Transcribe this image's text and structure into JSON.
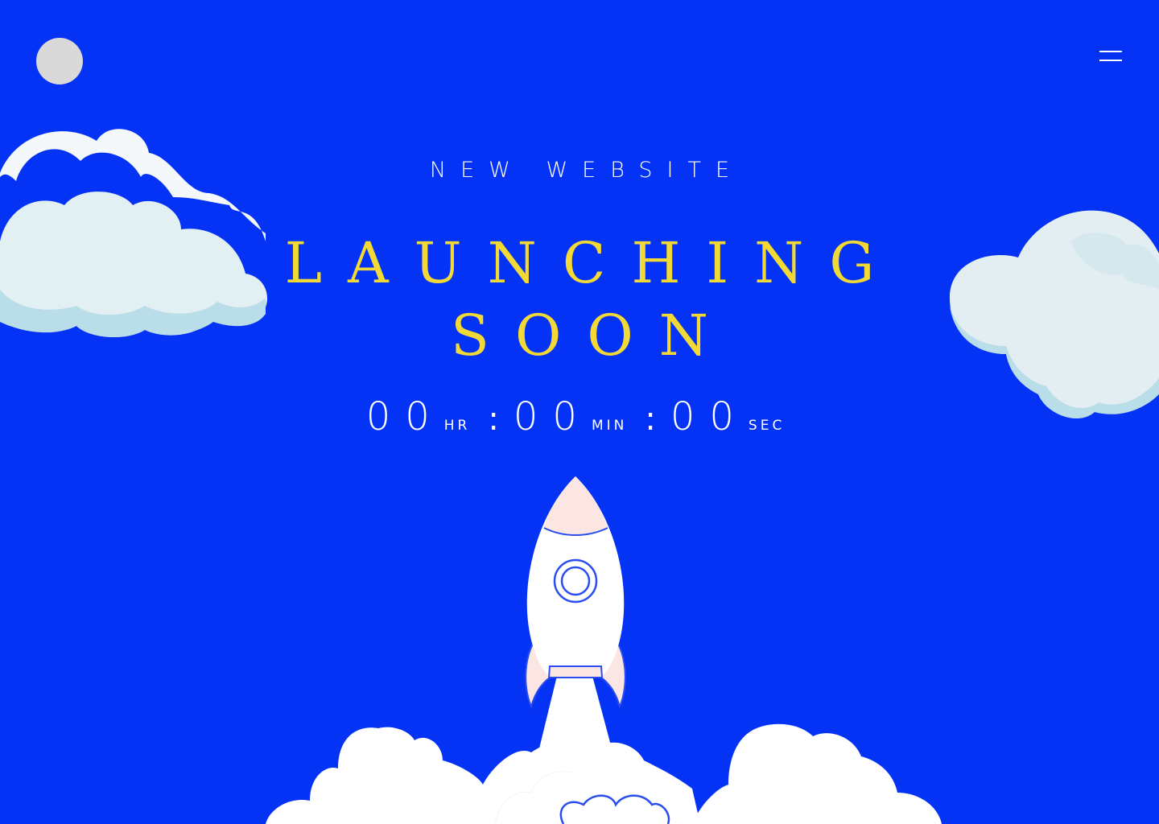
{
  "header": {
    "logo": "avatar-placeholder",
    "menu_icon": "hamburger-menu-icon"
  },
  "hero": {
    "eyebrow": "NEW WEBSITE",
    "headline_line1": "LAUNCHING",
    "headline_line2": "SOON"
  },
  "countdown": {
    "hours": "00",
    "hours_label": "HR",
    "minutes": "00",
    "minutes_label": "MIN",
    "seconds": "00",
    "seconds_label": "SEC",
    "separator": ":"
  },
  "colors": {
    "background": "#0433f5",
    "headline": "#f2d935",
    "text": "#ffffff",
    "logo": "#d9d9d9",
    "cloud_light": "#e4f0f4",
    "cloud_shadow": "#b8dde9",
    "rocket_body": "#ffffff",
    "rocket_nose": "#fbe6e4"
  },
  "illustrations": [
    "cloud-left",
    "cloud-right",
    "rocket",
    "launch-smoke"
  ]
}
